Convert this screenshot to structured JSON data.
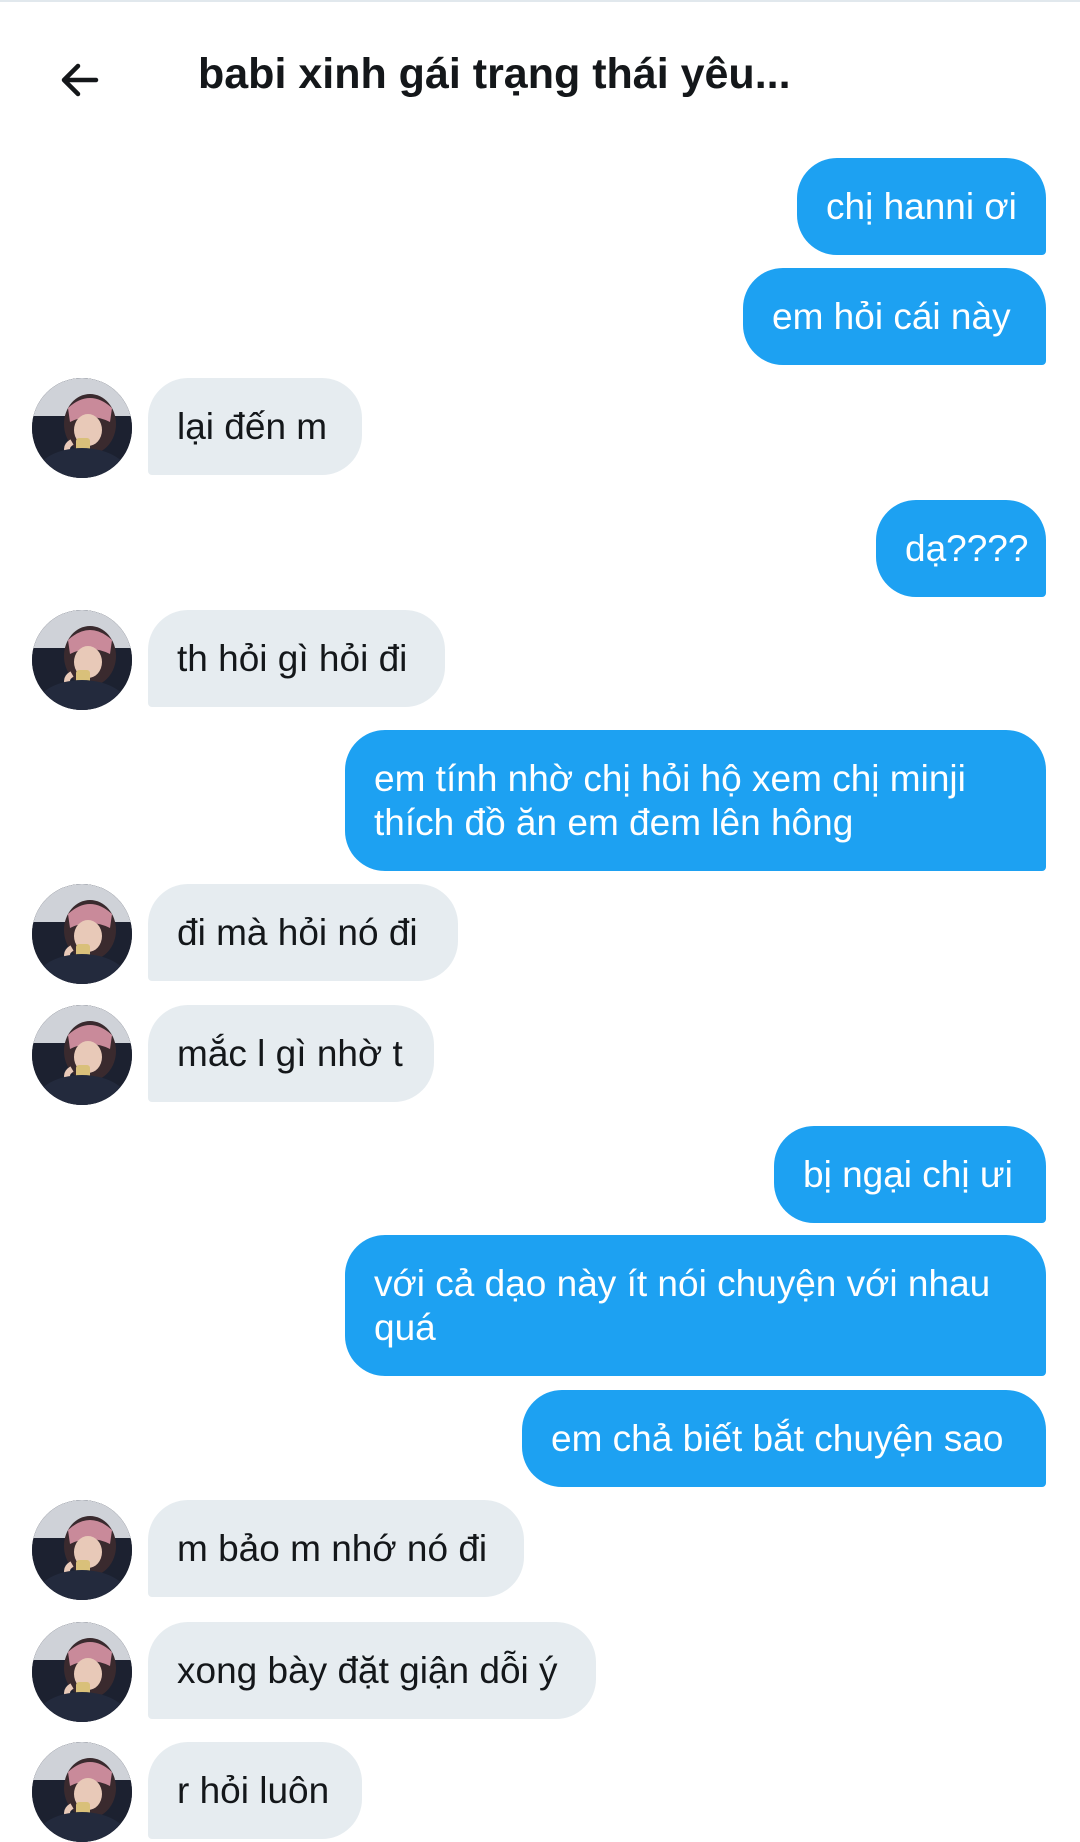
{
  "header": {
    "title": "babi xinh gái trạng thái yêu...",
    "back_icon": "arrow-left-icon"
  },
  "messages": [
    {
      "from": "me",
      "text": "chị hanni ơi"
    },
    {
      "from": "me",
      "text": "em hỏi cái này"
    },
    {
      "from": "them",
      "text": "lại đến m"
    },
    {
      "from": "me",
      "text": "dạ????"
    },
    {
      "from": "them",
      "text": "th hỏi gì hỏi đi"
    },
    {
      "from": "me",
      "text": "em tính nhờ chị hỏi hộ xem chị minji thích đồ ăn em đem lên hông"
    },
    {
      "from": "them",
      "text": "đi mà hỏi nó đi"
    },
    {
      "from": "them",
      "text": "mắc l gì nhờ t"
    },
    {
      "from": "me",
      "text": "bị ngại chị ưi"
    },
    {
      "from": "me",
      "text": "với cả dạo này ít nói chuyện với nhau quá"
    },
    {
      "from": "me",
      "text": "em chả biết bắt chuyện sao"
    },
    {
      "from": "them",
      "text": "m bảo m nhớ nó đi"
    },
    {
      "from": "them",
      "text": "xong bày đặt giận dỗi ý"
    },
    {
      "from": "them",
      "text": "r hỏi luôn"
    }
  ],
  "colors": {
    "sent_bubble": "#1da1f2",
    "received_bubble": "#e6ecf0",
    "text_dark": "#14171a"
  }
}
